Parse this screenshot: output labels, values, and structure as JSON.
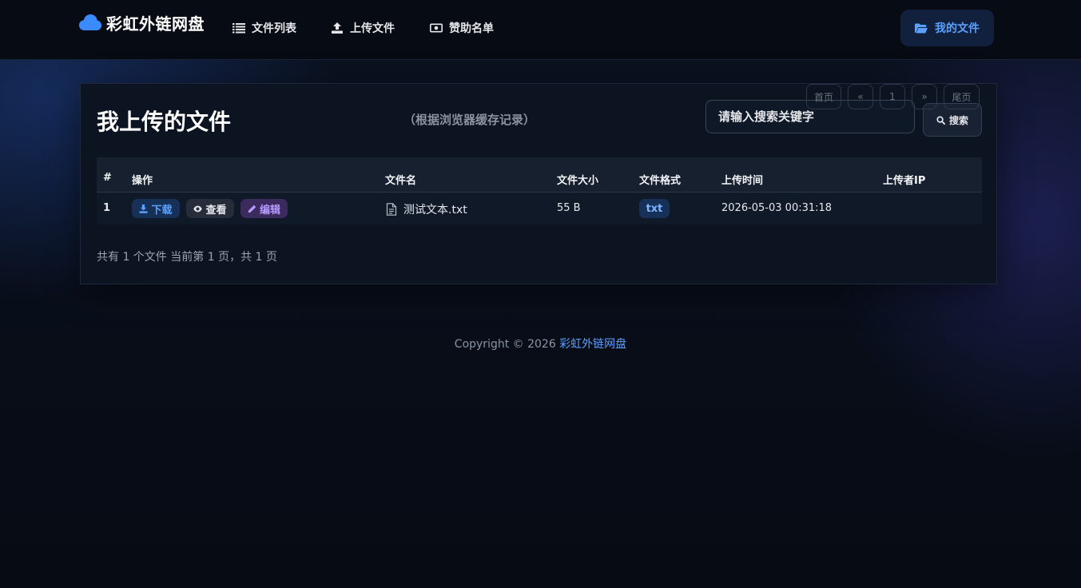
{
  "nav": {
    "brand": "彩虹外链网盘",
    "items": [
      {
        "label": "文件列表",
        "icon": "list-icon"
      },
      {
        "label": "上传文件",
        "icon": "upload-icon"
      },
      {
        "label": "赞助名单",
        "icon": "money-icon"
      }
    ],
    "my_files": "我的文件"
  },
  "card": {
    "title": "我上传的文件",
    "subtitle": "（根据浏览器缓存记录）",
    "search": {
      "placeholder": "请输入搜索关键字",
      "button": "搜索"
    }
  },
  "table": {
    "headers": [
      "#",
      "操作",
      "文件名",
      "文件大小",
      "文件格式",
      "上传时间",
      "上传者IP"
    ],
    "rows": [
      {
        "num": "1",
        "actions": {
          "download": "下载",
          "view": "查看",
          "edit": "编辑"
        },
        "filename": "测试文本.txt",
        "size": "55 B",
        "format": "txt",
        "time": "2026-05-03 00:31:18",
        "ip": ""
      }
    ]
  },
  "summary": "共有 1 个文件  当前第 1 页，共 1 页",
  "pagination": {
    "first": "首页",
    "prev": "«",
    "current": "1",
    "next": "»",
    "last": "尾页"
  },
  "footer": {
    "copyright": "Copyright © 2026 ",
    "site": "彩虹外链网盘"
  },
  "colors": {
    "accent": "#5aa0ff",
    "edit": "#b69bff",
    "background": "#080d18"
  }
}
